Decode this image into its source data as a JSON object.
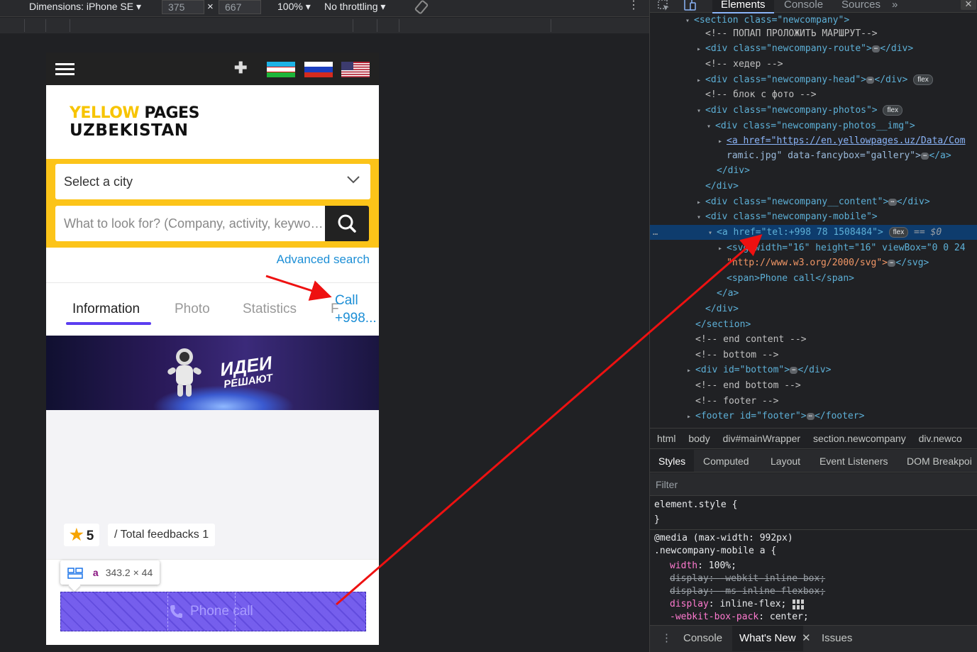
{
  "device_toolbar": {
    "dimensions_label": "Dimensions: iPhone SE",
    "width": "375",
    "height": "667",
    "times": "×",
    "zoom": "100%",
    "throttling": "No throttling",
    "more": "⋮"
  },
  "phone": {
    "plus": "✚",
    "logo_yellow": "YELLOW",
    "logo_pages": " PAGES",
    "logo_line2": "UZBEKISTAN",
    "city_select": "Select a city",
    "search_placeholder": "What to look for? (Company, activity, keyword)",
    "advanced_search": "Advanced search",
    "tabs": [
      "Information",
      "Photo",
      "Statistics",
      "F"
    ],
    "call_line1": "Call",
    "call_line2": "+998...",
    "banner_text1": "ИДЕИ",
    "banner_text2": "РЕШАЮТ",
    "rating_star": "★",
    "rating_value": "5",
    "feedbacks": "/ Total feedbacks 1",
    "tooltip_tag": "a",
    "tooltip_dims": "343.2 × 44",
    "phone_call": "Phone call",
    "colors": {
      "accent": "#fcc419",
      "tab_underline": "#5b3df0",
      "link": "#1d8fd6"
    }
  },
  "devtools": {
    "tabs": [
      "Elements",
      "Console",
      "Sources"
    ],
    "more_tabs": "»",
    "close": "✕",
    "dom_ellipsis": "…",
    "code_lines": [
      {
        "t": "<section class=\"newcompany\">"
      },
      {
        "t": "<!-- ПОПАП ПРОЛОЖИТЬ МАРШРУТ-->"
      },
      {
        "t": "<div class=\"newcompany-route\">"
      },
      {
        "t": "<!-- хедер -->"
      },
      {
        "t": "<div class=\"newcompany-head\">"
      },
      {
        "t": "<!-- блок с фото -->"
      },
      {
        "t": "<div class=\"newcompany-photos\">"
      },
      {
        "t": "<div class=\"newcompany-photos__img\">"
      },
      {
        "t": "<a href=\"https://en.yellowpages.uz/Data/Com"
      },
      {
        "t": "ramic.jpg\" data-fancybox=\"gallery\">"
      },
      {
        "t": "</div>"
      },
      {
        "t": "</div>"
      },
      {
        "t": "<div class=\"newcompany__content\">"
      },
      {
        "t": "<div class=\"newcompany-mobile\">"
      },
      {
        "t": "<a href=\"tel:+998 78 1508484\">"
      },
      {
        "t": "<svg width=\"16\" height=\"16\" viewBox=\"0 0 24"
      },
      {
        "t": "\"http://www.w3.org/2000/svg\">"
      },
      {
        "t": "<span>Phone call</span>"
      },
      {
        "t": "</a>"
      },
      {
        "t": "</div>"
      },
      {
        "t": "</section>"
      },
      {
        "t": "<!-- end content -->"
      },
      {
        "t": "<!-- bottom -->"
      },
      {
        "t": "<div id=\"bottom\">"
      },
      {
        "t": "<!-- end bottom -->"
      },
      {
        "t": "<!-- footer -->"
      },
      {
        "t": "<footer id=\"footer\">"
      }
    ],
    "pill_flex": "flex",
    "selected_suffix": "== $0",
    "breadcrumbs": [
      "html",
      "body",
      "div#mainWrapper",
      "section.newcompany",
      "div.newco"
    ],
    "styles_tabs": [
      "Styles",
      "Computed",
      "Layout",
      "Event Listeners",
      "DOM Breakpoi"
    ],
    "filter_placeholder": "Filter",
    "css": {
      "element_style": "element.style {",
      "close_brace": "}",
      "media": "@media (max-width: 992px)",
      "selector": ".newcompany-mobile a {",
      "rules": [
        {
          "prop": "width",
          "val": "100%;",
          "struck": false
        },
        {
          "prop": "display",
          "val": "-webkit-inline-box;",
          "struck": true
        },
        {
          "prop": "display",
          "val": "-ms-inline-flexbox;",
          "struck": true
        },
        {
          "prop": "display",
          "val": "inline-flex;",
          "struck": false
        },
        {
          "prop": "-webkit-box-pack",
          "val": "center;",
          "struck": false
        }
      ]
    },
    "drawer": [
      "Console",
      "What's New",
      "Issues"
    ],
    "drawer_close": "✕"
  }
}
